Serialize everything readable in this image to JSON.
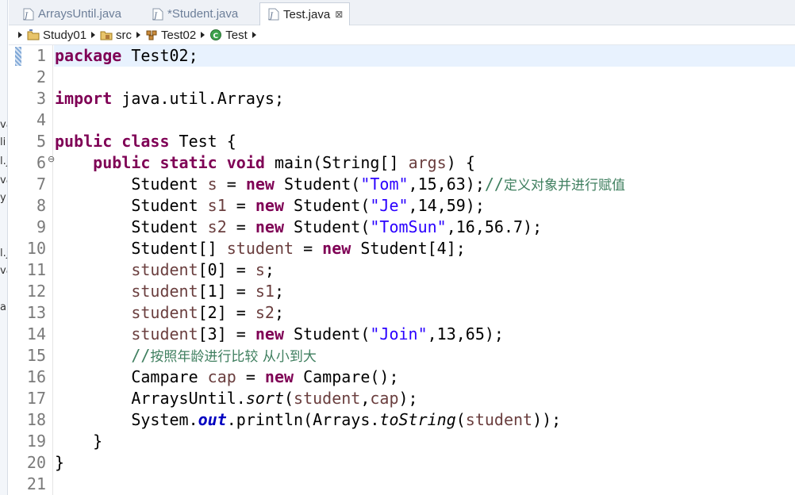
{
  "left_strip": {
    "fragments": [
      "va",
      "li",
      "l.j",
      "va",
      "y",
      "l.j",
      "va",
      "ar"
    ]
  },
  "tabs": [
    {
      "label": "ArraysUntil.java",
      "active": false,
      "icon": "java-file-icon"
    },
    {
      "label": "*Student.java",
      "active": false,
      "icon": "java-file-icon"
    },
    {
      "label": "Test.java",
      "active": true,
      "icon": "java-file-icon",
      "close": "⊠"
    }
  ],
  "breadcrumb": [
    {
      "label": "Study01",
      "icon": "project-icon"
    },
    {
      "label": "src",
      "icon": "package-folder-icon"
    },
    {
      "label": "Test02",
      "icon": "package-icon"
    },
    {
      "label": "Test",
      "icon": "class-icon"
    }
  ],
  "editor": {
    "current_line": 1,
    "fold_line": 6,
    "fold_symbol": "⊖",
    "line_numbers": [
      "1",
      "2",
      "3",
      "4",
      "5",
      "6",
      "7",
      "8",
      "9",
      "10",
      "11",
      "12",
      "13",
      "14",
      "15",
      "16",
      "17",
      "18",
      "19",
      "20",
      "21"
    ],
    "lines": [
      [
        {
          "t": "package",
          "c": "kw"
        },
        {
          "t": " Test02;"
        }
      ],
      [],
      [
        {
          "t": "import",
          "c": "kw"
        },
        {
          "t": " java.util.Arrays;"
        }
      ],
      [],
      [
        {
          "t": "public",
          "c": "kw"
        },
        {
          "t": " "
        },
        {
          "t": "class",
          "c": "kw"
        },
        {
          "t": " Test {"
        }
      ],
      [
        {
          "t": "    "
        },
        {
          "t": "public",
          "c": "kw"
        },
        {
          "t": " "
        },
        {
          "t": "static",
          "c": "kw"
        },
        {
          "t": " "
        },
        {
          "t": "void",
          "c": "kw"
        },
        {
          "t": " main(String[] "
        },
        {
          "t": "args",
          "c": "var"
        },
        {
          "t": ") {"
        }
      ],
      [
        {
          "t": "        Student "
        },
        {
          "t": "s",
          "c": "var"
        },
        {
          "t": " = "
        },
        {
          "t": "new",
          "c": "kw"
        },
        {
          "t": " Student("
        },
        {
          "t": "\"Tom\"",
          "c": "str"
        },
        {
          "t": ",15,63);"
        },
        {
          "t": "//",
          "c": "cm"
        },
        {
          "t": "定义对象并进行赋值",
          "c": "cm cjk"
        }
      ],
      [
        {
          "t": "        Student "
        },
        {
          "t": "s1",
          "c": "var"
        },
        {
          "t": " = "
        },
        {
          "t": "new",
          "c": "kw"
        },
        {
          "t": " Student("
        },
        {
          "t": "\"Je\"",
          "c": "str"
        },
        {
          "t": ",14,59);"
        }
      ],
      [
        {
          "t": "        Student "
        },
        {
          "t": "s2",
          "c": "var"
        },
        {
          "t": " = "
        },
        {
          "t": "new",
          "c": "kw"
        },
        {
          "t": " Student("
        },
        {
          "t": "\"TomSun\"",
          "c": "str"
        },
        {
          "t": ",16,56.7);"
        }
      ],
      [
        {
          "t": "        Student[] "
        },
        {
          "t": "student",
          "c": "var"
        },
        {
          "t": " = "
        },
        {
          "t": "new",
          "c": "kw"
        },
        {
          "t": " Student[4];"
        }
      ],
      [
        {
          "t": "        "
        },
        {
          "t": "student",
          "c": "var"
        },
        {
          "t": "[0] = "
        },
        {
          "t": "s",
          "c": "var"
        },
        {
          "t": ";"
        }
      ],
      [
        {
          "t": "        "
        },
        {
          "t": "student",
          "c": "var"
        },
        {
          "t": "[1] = "
        },
        {
          "t": "s1",
          "c": "var"
        },
        {
          "t": ";"
        }
      ],
      [
        {
          "t": "        "
        },
        {
          "t": "student",
          "c": "var"
        },
        {
          "t": "[2] = "
        },
        {
          "t": "s2",
          "c": "var"
        },
        {
          "t": ";"
        }
      ],
      [
        {
          "t": "        "
        },
        {
          "t": "student",
          "c": "var"
        },
        {
          "t": "[3] = "
        },
        {
          "t": "new",
          "c": "kw"
        },
        {
          "t": " Student("
        },
        {
          "t": "\"Join\"",
          "c": "str"
        },
        {
          "t": ",13,65);"
        }
      ],
      [
        {
          "t": "        "
        },
        {
          "t": "//",
          "c": "cm"
        },
        {
          "t": "按照年龄进行比较 从小到大",
          "c": "cm cjk"
        }
      ],
      [
        {
          "t": "        Campare "
        },
        {
          "t": "cap",
          "c": "var"
        },
        {
          "t": " = "
        },
        {
          "t": "new",
          "c": "kw"
        },
        {
          "t": " Campare();"
        }
      ],
      [
        {
          "t": "        ArraysUntil."
        },
        {
          "t": "sort",
          "c": "st"
        },
        {
          "t": "("
        },
        {
          "t": "student",
          "c": "var"
        },
        {
          "t": ","
        },
        {
          "t": "cap",
          "c": "var"
        },
        {
          "t": ");"
        }
      ],
      [
        {
          "t": "        System."
        },
        {
          "t": "out",
          "c": "fld"
        },
        {
          "t": ".println(Arrays."
        },
        {
          "t": "toString",
          "c": "st"
        },
        {
          "t": "("
        },
        {
          "t": "student",
          "c": "var"
        },
        {
          "t": "));"
        }
      ],
      [
        {
          "t": "    }"
        }
      ],
      [
        {
          "t": "}"
        }
      ],
      []
    ]
  },
  "colors": {
    "keyword": "#7f0055",
    "string": "#2a00ff",
    "comment": "#3f7f5f",
    "local_variable": "#6a3e3e",
    "static_field": "#0000c0",
    "current_line_bg": "#e8f2fe"
  }
}
